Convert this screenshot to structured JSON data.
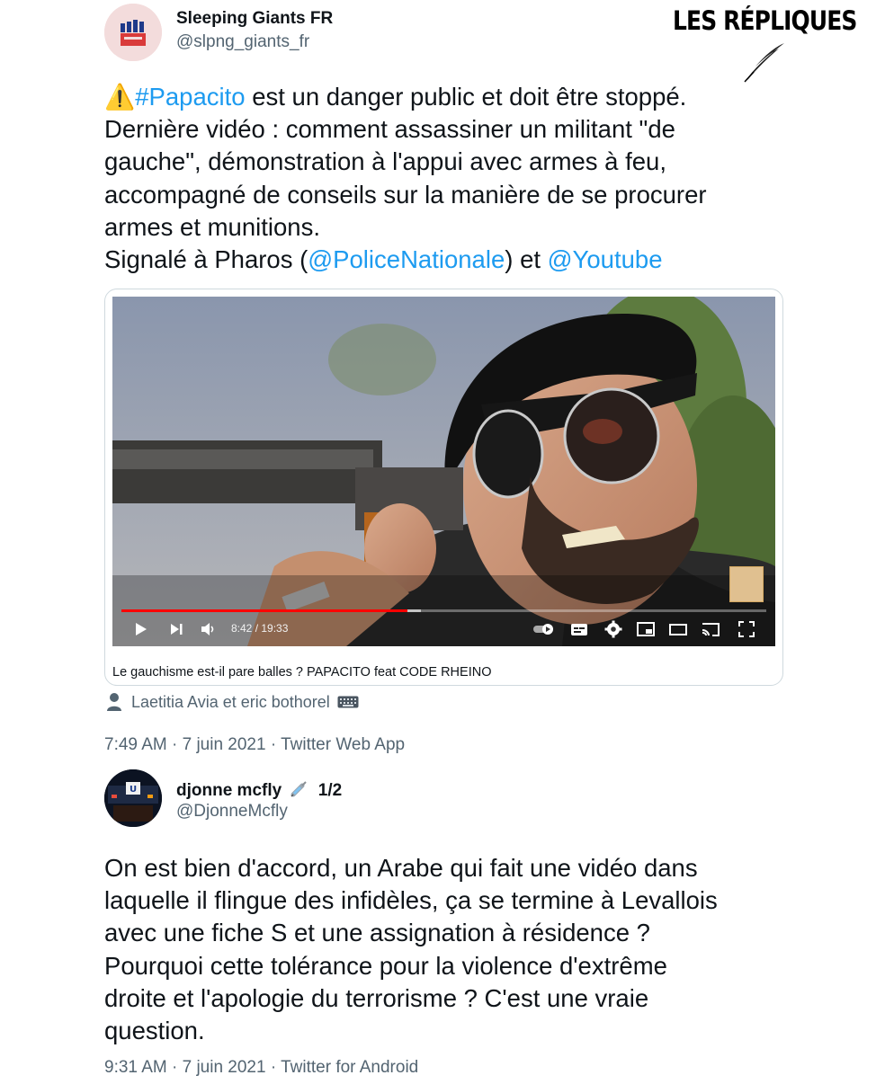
{
  "brand": {
    "title": "LES RÉPLIQUES"
  },
  "tweet1": {
    "display_name": "Sleeping Giants FR",
    "handle": "@slpng_giants_fr",
    "warning_emoji": "⚠️",
    "lines": {
      "l1_hashtag": "#Papacito",
      "l1_rest": " est un danger public et doit être stoppé.",
      "l2": "Dernière vidéo : comment assassiner un militant \"de",
      "l3": "gauche\", démonstration à l'appui avec armes à feu,",
      "l4": "accompagné de conseils sur la manière de se procurer",
      "l5": "armes et munitions.",
      "l6_pre": "Signalé à Pharos (",
      "l6_mention1": "@PoliceNationale",
      "l6_mid": ") et ",
      "l6_mention2": "@Youtube"
    },
    "video": {
      "time": "8:42 / 19:33",
      "played_fraction": 0.444,
      "buffered_fraction": 0.465,
      "caption": "Le gauchisme est-il pare balles ? PAPACITO feat CODE RHEINO"
    },
    "tagged_users": "Laetitia Avia et eric bothorel",
    "meta": "7:49 AM · 7 juin 2021 · Twitter Web App",
    "link_color": "#1d9bf0"
  },
  "tweet2": {
    "display_name": "djonne mcfly",
    "name_suffix": "1/2",
    "handle": "@DjonneMcfly",
    "lines": {
      "l1": "On est bien d'accord, un Arabe qui fait une vidéo dans",
      "l2": "laquelle il flingue des infidèles, ça se termine à Levallois",
      "l3": "avec une fiche S et une assignation à résidence ?",
      "l4": "Pourquoi cette tolérance pour la violence d'extrême",
      "l5": "droite et l'apologie du terrorisme ? C'est une vraie",
      "l6": "question."
    },
    "meta": "9:31 AM · 7 juin 2021 · Twitter for Android"
  }
}
